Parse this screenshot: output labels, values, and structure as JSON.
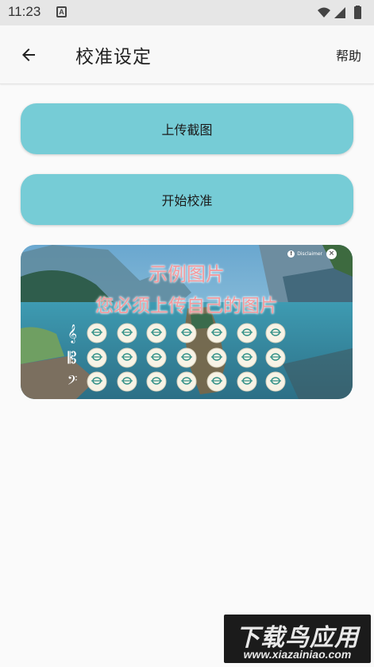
{
  "status_bar": {
    "time": "11:23",
    "notification_letter": "A",
    "icons": [
      "wifi-icon",
      "cellular-signal-icon",
      "battery-icon"
    ]
  },
  "app_bar": {
    "back_icon": "arrow-left-icon",
    "title": "校准设定",
    "help_label": "帮助"
  },
  "buttons": {
    "upload_label": "上传截图",
    "calibrate_label": "开始校准"
  },
  "example_image": {
    "title": "示例图片",
    "subtitle": "您必须上传自己的图片",
    "disclaimer_label": "Disclaimer",
    "disclaimer_icon": "exclamation-icon",
    "close_symbol": "×",
    "clefs": [
      "treble-clef-icon",
      "alto-clef-icon",
      "bass-clef-icon"
    ],
    "key_grid_rows": 3,
    "key_grid_cols": 7
  },
  "watermark": {
    "top_text": "下载鸟应用",
    "bottom_text": "www.xiazainiao.com"
  },
  "colors": {
    "accent_button": "#76ccd6",
    "background": "#fafafa",
    "overlay_text": "#f29a9e"
  }
}
